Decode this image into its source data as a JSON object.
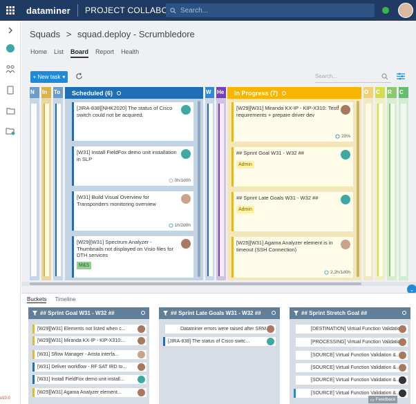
{
  "app": {
    "logo": "dataminer",
    "product": "PROJECT COLLABORATION",
    "search_placeholder": "Search...",
    "version": "v10.0"
  },
  "breadcrumb": {
    "root": "Squads",
    "sep1": ">",
    "current": "squad.deploy - Scrumbledore"
  },
  "tabs": [
    "Home",
    "List",
    "Board",
    "Report",
    "Health"
  ],
  "toolbar": {
    "new_task": "+ New task",
    "search_placeholder": "Search..."
  },
  "collapsed_left": [
    "N",
    "In",
    "To"
  ],
  "collapsed_mid": [
    "W",
    "He"
  ],
  "collapsed_right": [
    "O",
    "C",
    "R",
    "C"
  ],
  "scheduled": {
    "title": "Scheduled (6)",
    "cards": [
      {
        "text": "[JIRA-838][NHK2020] The status of Cisco switch could not be acquired.",
        "time": "",
        "tag": ""
      },
      {
        "text": "[W31] Install FieldFox demo unit installation in SLP",
        "time": "0h/1d0h",
        "tag": ""
      },
      {
        "text": "[W31] Build Visual Overview for Transponders monitoring overview",
        "time": "1h/2d0h",
        "tag": ""
      },
      {
        "text": "[W29][W31] Spectrum Analyzer - Thumbnails not displayed on Visio files for DTH services",
        "time": "",
        "tag": "M&S"
      }
    ]
  },
  "in_progress": {
    "title": "In Progress (7)",
    "cards": [
      {
        "text": "[W29][W31] Miranda KX-IP - KIP-X310: Test requirements + prepare driver dev",
        "time": "20%",
        "tag": ""
      },
      {
        "text": "## Sprint Goal W31 - W32 ##",
        "time": "",
        "tag": "Admin"
      },
      {
        "text": "## Sprint Late Goals W31 - W32 ##",
        "time": "",
        "tag": "Admin"
      },
      {
        "text": "[W25][W31] Agama Analyzer element is in timeout (SSH Connection)",
        "time": "2.2h/1d0h",
        "tag": ""
      }
    ]
  },
  "lower_tabs": [
    "Buckets",
    "Timeline"
  ],
  "buckets": [
    {
      "title": "## Sprint Goal W31 - W32 ##",
      "items": [
        "[W29][W31] Elements not listed when c...",
        "[W29][W31] Miranda KX-IP - KIP-X310:...",
        "[W31] Sflow Manager - Arista interfa...",
        "[W31] Deliver workflow - RF SAT IRD to...",
        "[W31] Install FieldFox demo unit install...",
        "[W25][W31] Agama Analyzer element..."
      ]
    },
    {
      "title": "## Sprint Late Goals W31 - W32 ##",
      "items": [
        "Dataminer errors were raised after SRM...",
        "[JIRA-838]            The status of Cisco switc..."
      ]
    },
    {
      "title": "## Sprint Stretch Goal ##",
      "items": [
        "[DESTINATION] Virtual Function Validatio...",
        "[PROCESSING] Virtual Function Validatio...",
        "[SOURCE] Virtual Function Validation &...",
        "[SOURCE] Virtual Function Validation &...",
        "[SOURCE] Virtual Function Validation &...",
        "[SOURCE] Virtual Function Validation &..."
      ]
    }
  ],
  "feedback": "Feedback",
  "colors": {
    "topbar": "#1f3b63",
    "scheduled": "#1f6eb5",
    "in_progress": "#f7b500",
    "accent": "#1f8ad8"
  }
}
